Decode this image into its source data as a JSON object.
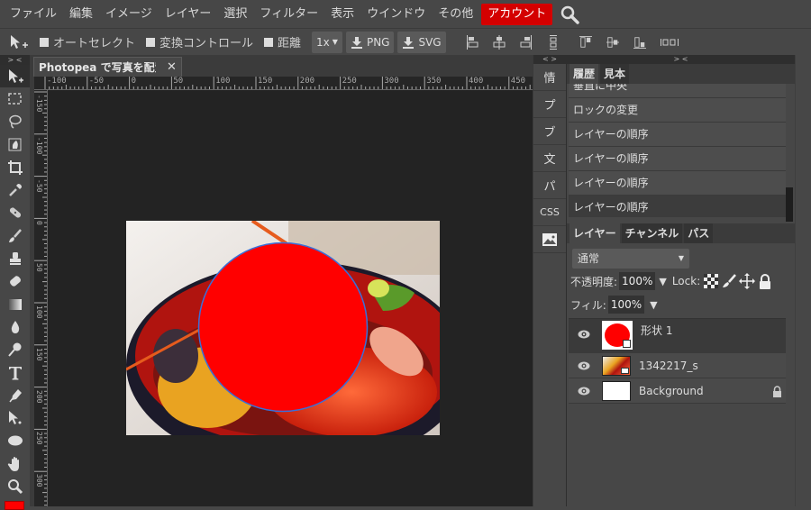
{
  "menu": {
    "items": [
      "ファイル",
      "編集",
      "イメージ",
      "レイヤー",
      "選択",
      "フィルター",
      "表示",
      "ウインドウ",
      "その他"
    ],
    "account": "アカウント",
    "search_icon": "search-icon"
  },
  "options": {
    "auto_select": "オートセレクト",
    "transform_controls": "変換コントロール",
    "distances": "距離",
    "scale": "1x",
    "png": "PNG",
    "svg": "SVG",
    "auto_select_checked": false,
    "transform_checked": false,
    "distances_checked": false
  },
  "toolbar": {
    "collapse": "> <",
    "tools": [
      "move",
      "marquee",
      "lasso",
      "quick-select",
      "crop",
      "eyedropper",
      "healing",
      "brush",
      "stamp",
      "eraser",
      "gradient",
      "blur",
      "dodge",
      "type",
      "pen",
      "path-select",
      "ellipse",
      "hand",
      "zoom"
    ],
    "foreground_color": "#ff0000"
  },
  "document": {
    "tab_title": "Photopea で写真を配置",
    "close": "✕"
  },
  "rulers": {
    "horizontal": [
      "-100",
      "-50",
      "0",
      "50",
      "100",
      "150",
      "200",
      "250",
      "300",
      "350",
      "400",
      "450"
    ],
    "vertical": [
      "-150",
      "-100",
      "-50",
      "0",
      "50",
      "100",
      "150",
      "200",
      "250",
      "300"
    ]
  },
  "canvas": {
    "shape_color": "#ff0000",
    "shape_outline": "#3a6fd8"
  },
  "midpanel": {
    "collapse": "< >",
    "buttons": [
      "情",
      "プ",
      "ブ",
      "文",
      "パ",
      "CSS"
    ]
  },
  "history": {
    "collapse": "> <",
    "tabs": [
      "履歴",
      "見本"
    ],
    "items": [
      "垂直に中央",
      "ロックの変更",
      "レイヤーの順序",
      "レイヤーの順序",
      "レイヤーの順序",
      "レイヤーの順序"
    ]
  },
  "layers": {
    "tabs": [
      "レイヤー",
      "チャンネル",
      "パス"
    ],
    "blend_mode": "通常",
    "opacity_label": "不透明度:",
    "opacity": "100%",
    "lock_label": "Lock:",
    "fill_label": "フィル:",
    "fill": "100%",
    "items": [
      {
        "name": "形状 1",
        "type": "shape",
        "visible": true,
        "selected": true
      },
      {
        "name": "1342217_s",
        "type": "smart-object",
        "visible": true,
        "selected": false
      },
      {
        "name": "Background",
        "type": "background",
        "visible": true,
        "selected": false,
        "locked": true
      }
    ]
  }
}
